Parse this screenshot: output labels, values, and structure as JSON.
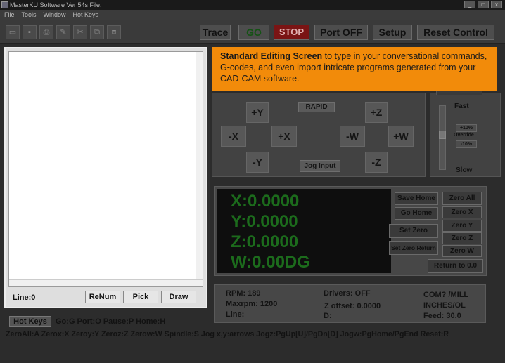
{
  "window": {
    "title": "MasterKU Software Ver 54s File:",
    "controls": [
      "_",
      "□",
      "x"
    ]
  },
  "menu": [
    "File",
    "Tools",
    "Window",
    "Hot Keys"
  ],
  "toolbar": {
    "icons": [
      "open-folder-icon",
      "save-icon",
      "print-icon",
      "edit-icon",
      "cut-icon",
      "copy-icon",
      "paste-icon"
    ],
    "icon_glyphs": [
      "▭",
      "▪",
      "⎙",
      "✎",
      "✂",
      "⧉",
      "⧈"
    ],
    "trace": "Trace",
    "go": "GO",
    "stop": "STOP",
    "port_off": "Port OFF",
    "setup": "Setup",
    "reset_control": "Reset Control"
  },
  "editor": {
    "line_label": "Line:0",
    "renum": "ReNum",
    "pick": "Pick",
    "draw": "Draw"
  },
  "jog": {
    "plus_y": "+Y",
    "minus_y": "-Y",
    "minus_x": "-X",
    "plus_x": "+X",
    "plus_z": "+Z",
    "minus_z": "-Z",
    "minus_w": "-W",
    "plus_w": "+W",
    "rapid": "RAPID",
    "jog_input": "Jog Input"
  },
  "speed": {
    "fast": "Fast",
    "slow": "Slow",
    "plus10": "+10%",
    "override": "Override",
    "minus10": "-10%",
    "level": 0.55
  },
  "dro": {
    "x": "X:0.0000",
    "y": "Y:0.0000",
    "z": "Z:0.0000",
    "w": "W:0.00DG",
    "save_home": "Save Home",
    "go_home": "Go Home",
    "set_zero": "Set Zero",
    "set_zero_return": "Set Zero Return",
    "zero_all": "Zero All",
    "zero_x": "Zero X",
    "zero_y": "Zero Y",
    "zero_z": "Zero Z",
    "zero_w": "Zero W",
    "return_to_0": "Return to 0.0"
  },
  "status": {
    "rpm": "RPM: 189",
    "maxrpm": "Maxrpm: 1200",
    "line": "Line:",
    "drivers": "Drivers: OFF",
    "z_offset": "Z offset: 0.0000",
    "d": "D:",
    "com": "COM? /MILL",
    "units": "INCHES/OL",
    "feed": "Feed: 30.0"
  },
  "hotkeys": {
    "button": "Hot Keys",
    "line1": "Go:G  Port:O  Pause:P  Home:H",
    "line2": "ZeroAll:A  Zerox:X  Zeroy:Y  Zeroz:Z  Zerow:W  Spindle:S  Jog x,y:arrows  Jogz:PgUp[U]/PgDn[D]  Jogw:PgHome/PgEnd  Reset:R"
  },
  "callout": {
    "heading": "Standard Editing Screen",
    "body": " to type in your conversational commands, G-codes, and even import intricate programs generated from your CAD-CAM software."
  }
}
